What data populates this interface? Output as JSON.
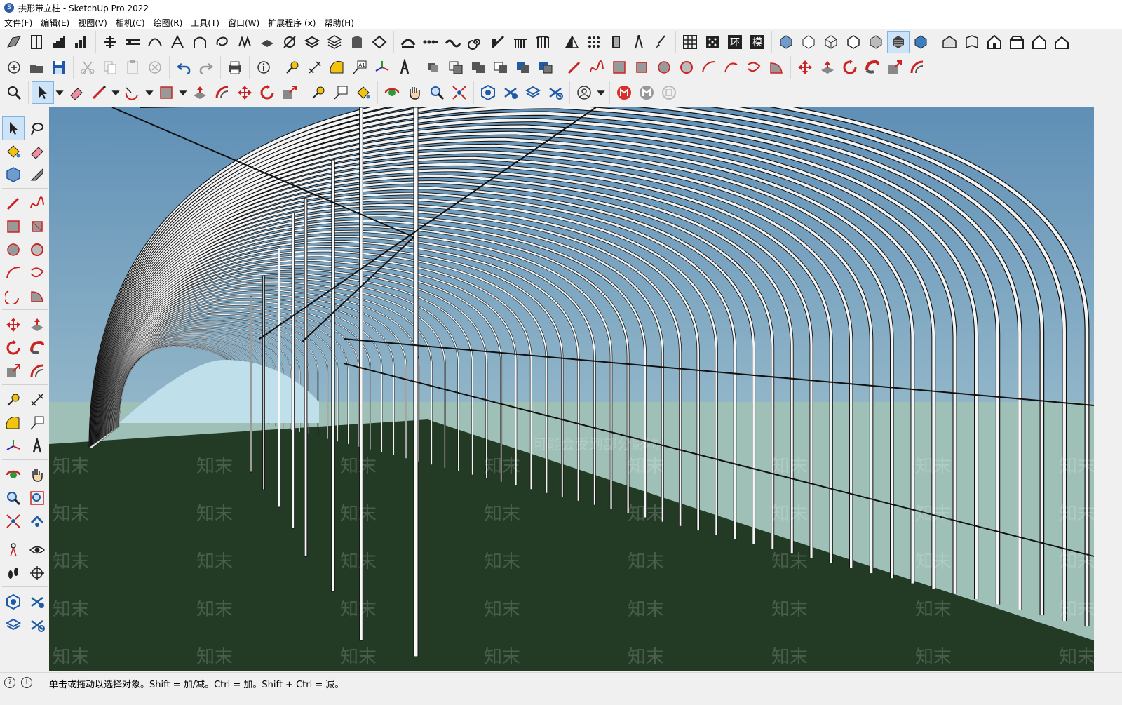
{
  "window": {
    "title": "拱形带立柱 - SketchUp Pro 2022"
  },
  "menubar": {
    "items": [
      "文件(F)",
      "编辑(E)",
      "视图(V)",
      "相机(C)",
      "绘图(R)",
      "工具(T)",
      "窗口(W)",
      "扩展程序 (x)",
      "帮助(H)"
    ]
  },
  "toolbar": {
    "style_labels": [
      "环",
      "模"
    ],
    "text_tool_tag": "A1"
  },
  "viewport": {
    "watermark_text": "知末",
    "watermark_notice": "可能会受到部分影响",
    "colors": {
      "sky": "#6f9cbf",
      "ground": "#233a24",
      "frame": "#f4f4f4",
      "edge": "#111111"
    }
  },
  "statusbar": {
    "icons": [
      "?",
      "i"
    ],
    "hint": "单击或拖动以选择对象。Shift = 加/减。Ctrl = 加。Shift + Ctrl = 减。"
  }
}
